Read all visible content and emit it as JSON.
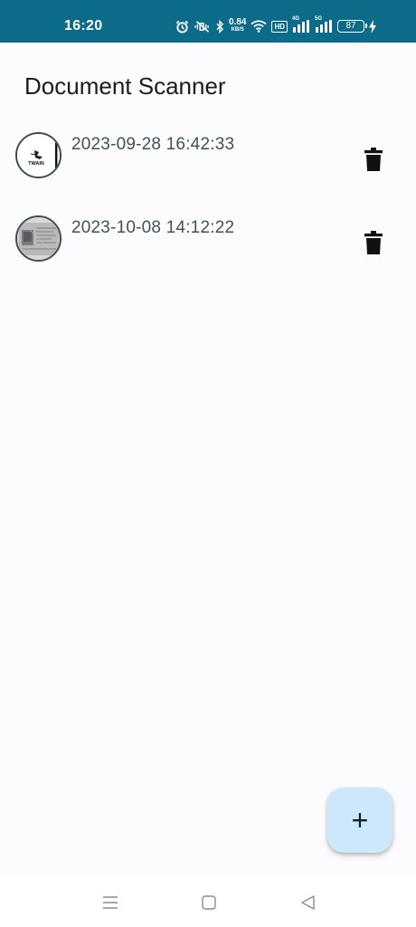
{
  "status_bar": {
    "time": "16:20",
    "net_speed_value": "0.84",
    "net_speed_unit": "KB/S",
    "hd_label": "HD",
    "signal1_tag": "4G",
    "signal2_tag": "5G",
    "battery_level": "87",
    "icons": [
      "alarm-icon",
      "mute-vibrate-icon",
      "bluetooth-icon",
      "wifi-icon",
      "signal-icon",
      "signal-icon",
      "battery-icon",
      "charging-icon"
    ]
  },
  "app": {
    "title": "Document Scanner"
  },
  "documents": [
    {
      "date": "2023-09-28 16:42:33",
      "thumbnail_text": "TWAIN",
      "delete_icon": "trash-icon"
    },
    {
      "date": "2023-10-08 14:12:22",
      "thumbnail_text": "",
      "delete_icon": "trash-icon"
    }
  ],
  "fab": {
    "label": "+",
    "icon": "add-icon"
  },
  "nav_bar": {
    "icons": [
      "menu-icon",
      "home-icon",
      "back-icon"
    ]
  },
  "colors": {
    "status_bar": "#0d6b8a",
    "background": "#fcfbfe",
    "fab": "#cde7fb",
    "text": "#44505a"
  }
}
